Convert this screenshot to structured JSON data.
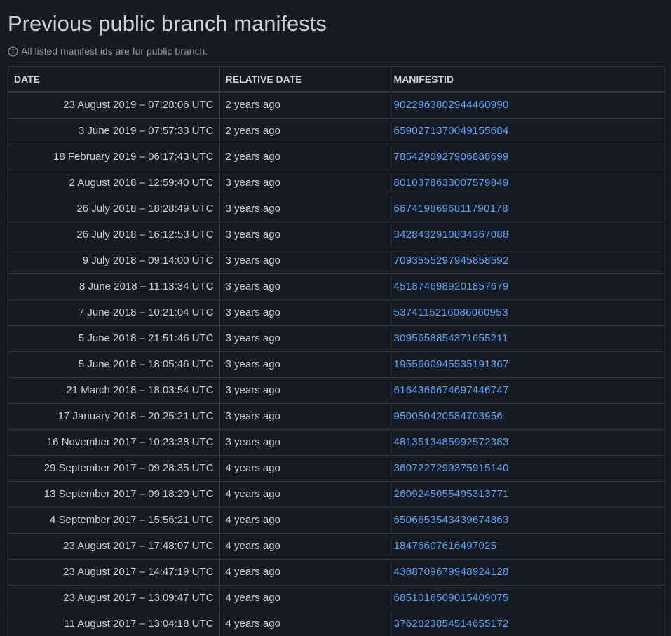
{
  "page": {
    "title": "Previous public branch manifests",
    "notice": "All listed manifest ids are for public branch."
  },
  "table": {
    "headers": [
      "DATE",
      "RELATIVE DATE",
      "MANIFESTID"
    ],
    "rows": [
      {
        "date": "23 August 2019 – 07:28:06 UTC",
        "relative": "2 years ago",
        "manifest": "9022963802944460990"
      },
      {
        "date": "3 June 2019 – 07:57:33 UTC",
        "relative": "2 years ago",
        "manifest": "6590271370049155684"
      },
      {
        "date": "18 February 2019 – 06:17:43 UTC",
        "relative": "2 years ago",
        "manifest": "7854290927906888699"
      },
      {
        "date": "2 August 2018 – 12:59:40 UTC",
        "relative": "3 years ago",
        "manifest": "8010378633007579849"
      },
      {
        "date": "26 July 2018 – 18:28:49 UTC",
        "relative": "3 years ago",
        "manifest": "6674198696811790178"
      },
      {
        "date": "26 July 2018 – 16:12:53 UTC",
        "relative": "3 years ago",
        "manifest": "3428432910834367088"
      },
      {
        "date": "9 July 2018 – 09:14:00 UTC",
        "relative": "3 years ago",
        "manifest": "7093555297945858592"
      },
      {
        "date": "8 June 2018 – 11:13:34 UTC",
        "relative": "3 years ago",
        "manifest": "4518746989201857679"
      },
      {
        "date": "7 June 2018 – 10:21:04 UTC",
        "relative": "3 years ago",
        "manifest": "5374115216086060953"
      },
      {
        "date": "5 June 2018 – 21:51:46 UTC",
        "relative": "3 years ago",
        "manifest": "3095658854371655211"
      },
      {
        "date": "5 June 2018 – 18:05:46 UTC",
        "relative": "3 years ago",
        "manifest": "1955660945535191367"
      },
      {
        "date": "21 March 2018 – 18:03:54 UTC",
        "relative": "3 years ago",
        "manifest": "6164366674697446747"
      },
      {
        "date": "17 January 2018 – 20:25:21 UTC",
        "relative": "3 years ago",
        "manifest": "950050420584703956"
      },
      {
        "date": "16 November 2017 – 10:23:38 UTC",
        "relative": "3 years ago",
        "manifest": "4813513485992572383"
      },
      {
        "date": "29 September 2017 – 09:28:35 UTC",
        "relative": "4 years ago",
        "manifest": "3607227299375915140"
      },
      {
        "date": "13 September 2017 – 09:18:20 UTC",
        "relative": "4 years ago",
        "manifest": "2609245055495313771"
      },
      {
        "date": "4 September 2017 – 15:56:21 UTC",
        "relative": "4 years ago",
        "manifest": "6506653543439674863"
      },
      {
        "date": "23 August 2017 – 17:48:07 UTC",
        "relative": "4 years ago",
        "manifest": "18476607616497025"
      },
      {
        "date": "23 August 2017 – 14:47:19 UTC",
        "relative": "4 years ago",
        "manifest": "4388709679948924128"
      },
      {
        "date": "23 August 2017 – 13:09:47 UTC",
        "relative": "4 years ago",
        "manifest": "6851016509015409075"
      },
      {
        "date": "11 August 2017 – 13:04:18 UTC",
        "relative": "4 years ago",
        "manifest": "3762023854514655172"
      },
      {
        "date": "",
        "relative": "",
        "manifest": ""
      }
    ]
  },
  "icons": {
    "notice_icon": "info-icon"
  },
  "colors": {
    "background": "#161b22",
    "text": "#c9d1d9",
    "muted": "#8b949e",
    "border": "#30363d",
    "link": "#58a6ff"
  }
}
